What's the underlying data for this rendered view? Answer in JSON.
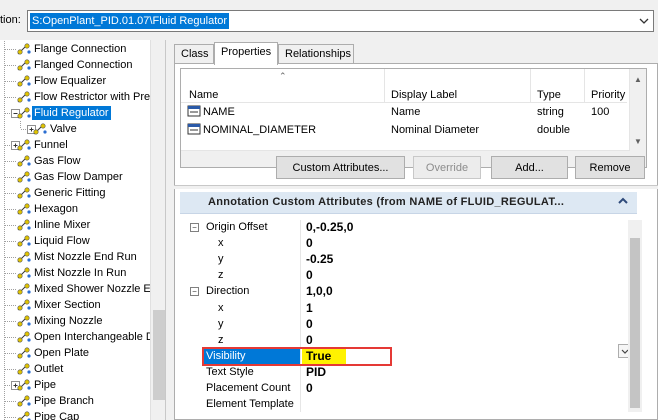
{
  "location": {
    "label": "tion:",
    "value": "S:OpenPlant_PID.01.07\\Fluid Regulator"
  },
  "tree": {
    "items": [
      {
        "label": "Flange Connection",
        "level": 1,
        "expander": false,
        "selected": false
      },
      {
        "label": "Flanged Connection",
        "level": 1,
        "expander": false,
        "selected": false
      },
      {
        "label": "Flow Equalizer",
        "level": 1,
        "expander": false,
        "selected": false
      },
      {
        "label": "Flow Restrictor with Pres",
        "level": 1,
        "expander": false,
        "selected": false
      },
      {
        "label": "Fluid Regulator",
        "level": 1,
        "expander": "minus",
        "selected": true
      },
      {
        "label": "Valve",
        "level": 2,
        "expander": "plus",
        "selected": false
      },
      {
        "label": "Funnel",
        "level": 1,
        "expander": "plus",
        "selected": false
      },
      {
        "label": "Gas Flow",
        "level": 1,
        "expander": false,
        "selected": false
      },
      {
        "label": "Gas Flow Damper",
        "level": 1,
        "expander": false,
        "selected": false
      },
      {
        "label": "Generic Fitting",
        "level": 1,
        "expander": false,
        "selected": false
      },
      {
        "label": "Hexagon",
        "level": 1,
        "expander": false,
        "selected": false
      },
      {
        "label": "Inline Mixer",
        "level": 1,
        "expander": false,
        "selected": false
      },
      {
        "label": "Liquid Flow",
        "level": 1,
        "expander": false,
        "selected": false
      },
      {
        "label": "Mist Nozzle End Run",
        "level": 1,
        "expander": false,
        "selected": false
      },
      {
        "label": "Mist Nozzle In Run",
        "level": 1,
        "expander": false,
        "selected": false
      },
      {
        "label": "Mixed Shower Nozzle Er",
        "level": 1,
        "expander": false,
        "selected": false
      },
      {
        "label": "Mixer Section",
        "level": 1,
        "expander": false,
        "selected": false
      },
      {
        "label": "Mixing Nozzle",
        "level": 1,
        "expander": false,
        "selected": false
      },
      {
        "label": "Open Interchangeable D",
        "level": 1,
        "expander": false,
        "selected": false
      },
      {
        "label": "Open Plate",
        "level": 1,
        "expander": false,
        "selected": false
      },
      {
        "label": "Outlet",
        "level": 1,
        "expander": false,
        "selected": false
      },
      {
        "label": "Pipe",
        "level": 1,
        "expander": "plus",
        "selected": false
      },
      {
        "label": "Pipe Branch",
        "level": 1,
        "expander": false,
        "selected": false
      },
      {
        "label": "Pipe Cap",
        "level": 1,
        "expander": false,
        "selected": false
      }
    ]
  },
  "tabs": [
    {
      "label": "Class",
      "active": false
    },
    {
      "label": "Properties",
      "active": true
    },
    {
      "label": "Relationships",
      "active": false
    }
  ],
  "properties": {
    "columns": [
      "Name",
      "Display Label",
      "Type",
      "Priority"
    ],
    "rows": [
      {
        "name": "NAME",
        "display_label": "Name",
        "type": "string",
        "priority": "100"
      },
      {
        "name": "NOMINAL_DIAMETER",
        "display_label": "Nominal Diameter",
        "type": "double",
        "priority": ""
      }
    ]
  },
  "buttons": {
    "custom_attributes": "Custom Attributes...",
    "override": "Override",
    "add": "Add...",
    "remove": "Remove"
  },
  "annotation": {
    "title": "Annotation Custom Attributes (from NAME of FLUID_REGULAT...",
    "rows": [
      {
        "label": "Origin Offset",
        "value": "0,-0.25,0",
        "indent": 0,
        "expander": "minus"
      },
      {
        "label": "x",
        "value": "0",
        "indent": 1,
        "expander": false
      },
      {
        "label": "y",
        "value": "-0.25",
        "indent": 1,
        "expander": false
      },
      {
        "label": "z",
        "value": "0",
        "indent": 1,
        "expander": false
      },
      {
        "label": "Direction",
        "value": "1,0,0",
        "indent": 0,
        "expander": "minus"
      },
      {
        "label": "x",
        "value": "1",
        "indent": 1,
        "expander": false
      },
      {
        "label": "y",
        "value": "0",
        "indent": 1,
        "expander": false
      },
      {
        "label": "z",
        "value": "0",
        "indent": 1,
        "expander": false
      },
      {
        "label": "Visibility",
        "value": "True",
        "indent": 0,
        "expander": false
      },
      {
        "label": "Text Style",
        "value": "PID",
        "indent": 0,
        "expander": false
      },
      {
        "label": "Placement Count",
        "value": "0",
        "indent": 0,
        "expander": false
      },
      {
        "label": "Element Template",
        "value": "",
        "indent": 0,
        "expander": false
      }
    ]
  },
  "colors": {
    "selection": "#0078d7",
    "highlight": "#fff200",
    "outline": "#e53935",
    "header": "#dde8f3"
  }
}
